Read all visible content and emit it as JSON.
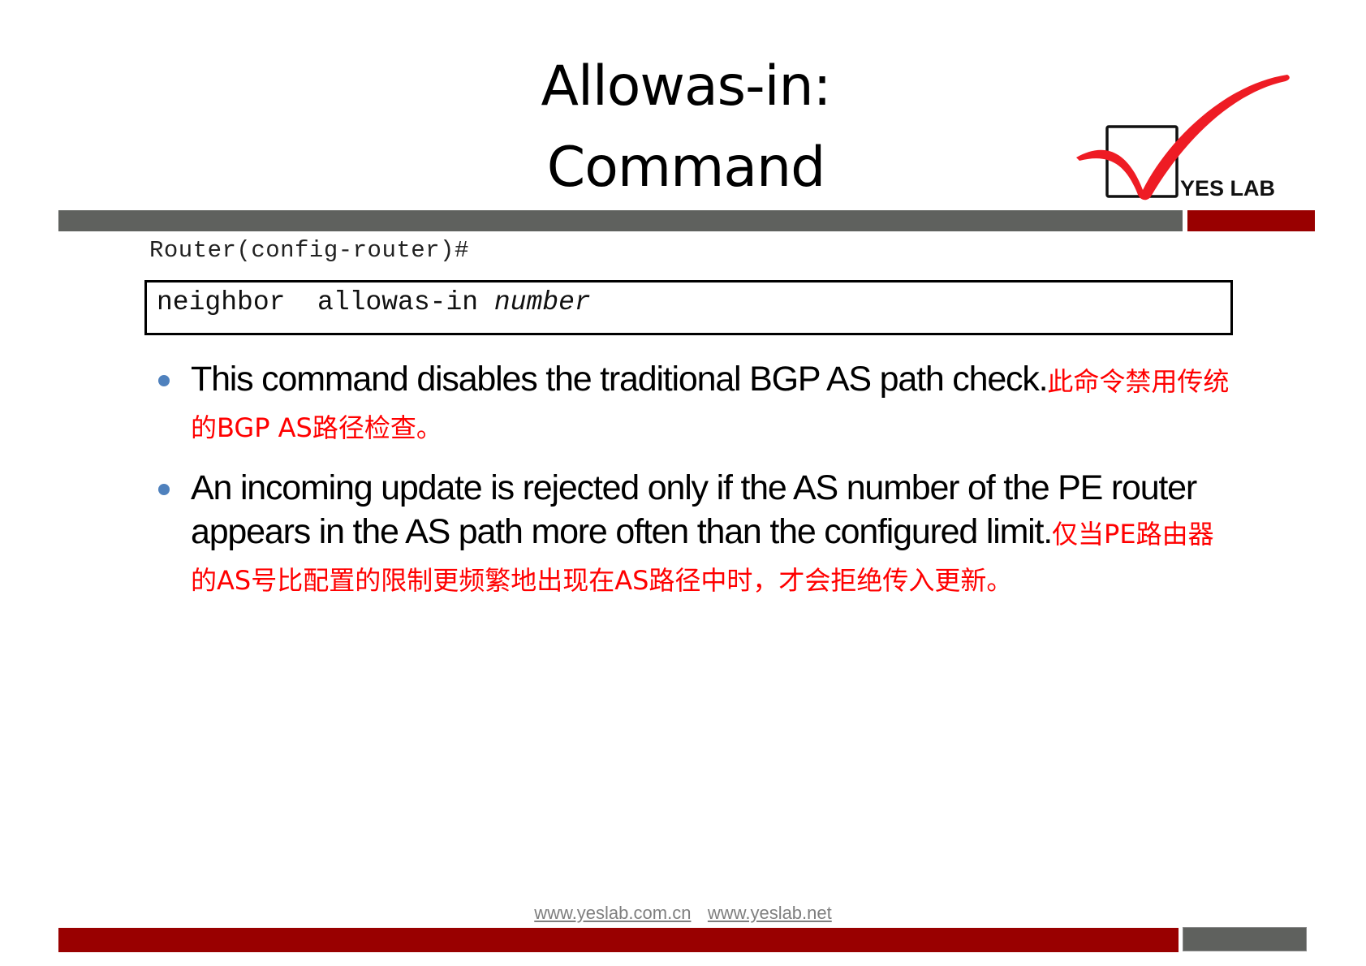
{
  "slide": {
    "title_line1": "Allowas-in:",
    "title_line2": "Command",
    "logo": {
      "text": "YES LAB",
      "icon": "checkmark-box-icon",
      "check_color": "#ee1c24"
    },
    "colors": {
      "accent_red": "#990000",
      "bar_gray": "#5f615e",
      "bullet_blue": "#4f81bd",
      "translation_red": "#ff0000",
      "link_gray": "#7f7f7f"
    },
    "prompt": "Router(config-router)#",
    "command": {
      "keyword": "neighbor  allowas-in ",
      "argument": "number"
    },
    "bullets": [
      {
        "en": "This command disables the traditional BGP AS path check.",
        "zh": "此命令禁用传统的BGP AS路径检查。"
      },
      {
        "en": "An incoming update is rejected only if the AS number of the PE router appears in the AS path more often than the configured limit.",
        "zh": "仅当PE路由器的AS号比配置的限制更频繁地出现在AS路径中时，才会拒绝传入更新。"
      }
    ],
    "footer_links": [
      "www.yeslab.com.cn",
      "www.yeslab.net"
    ]
  }
}
